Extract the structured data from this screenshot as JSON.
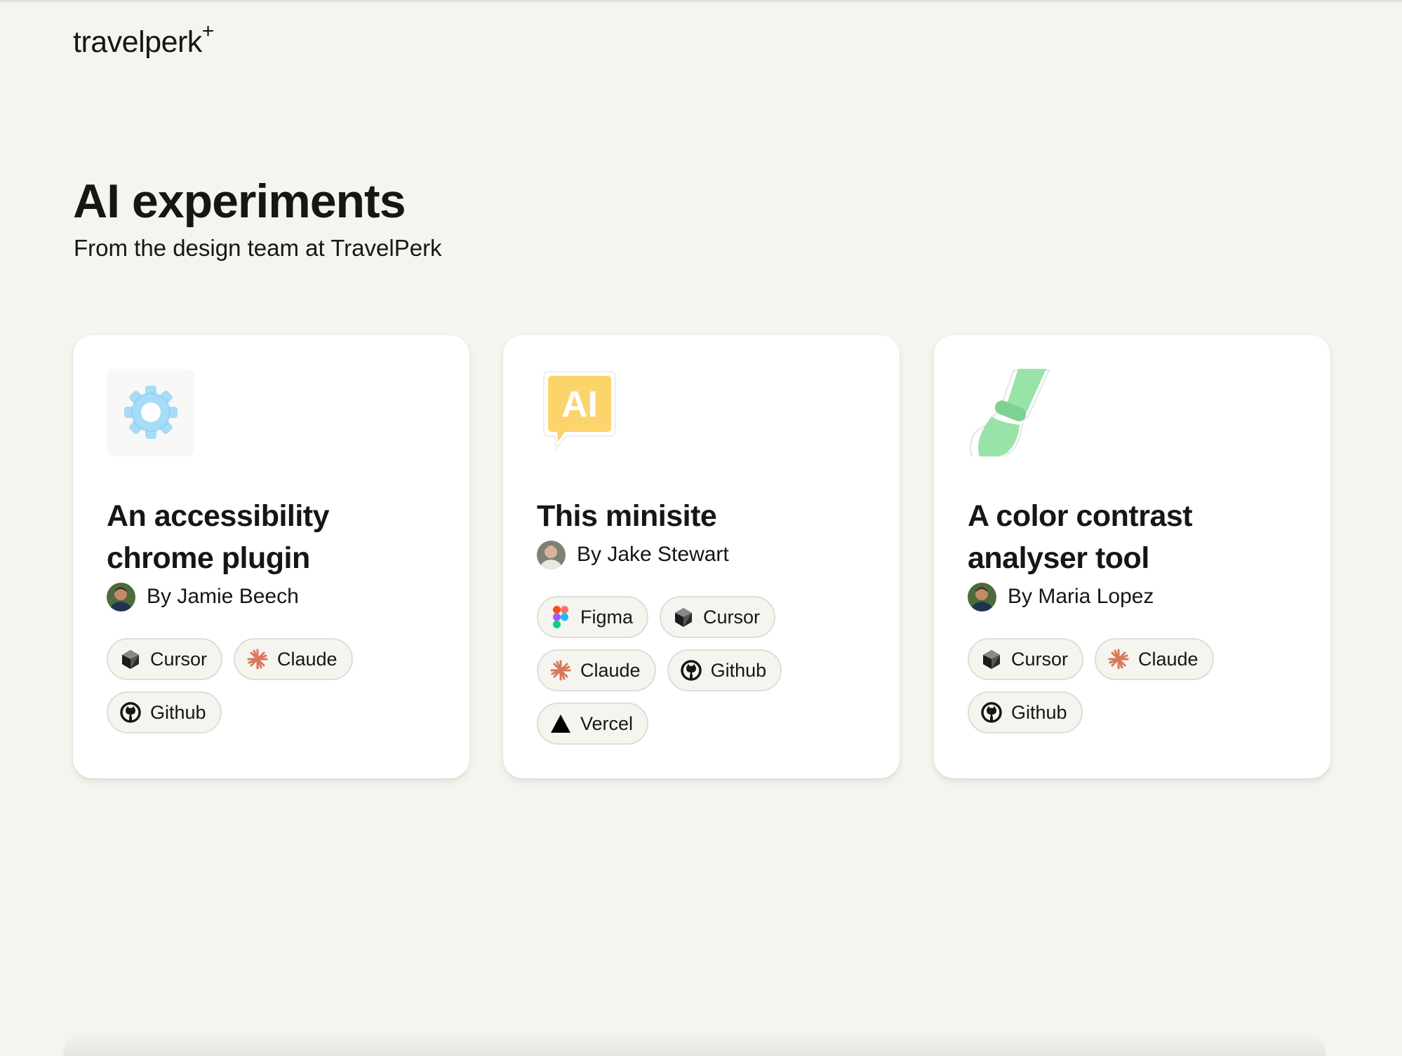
{
  "brand": {
    "logo_text": "travelperk",
    "logo_mark": "+"
  },
  "header": {
    "title": "AI experiments",
    "subtitle": "From the design team at TravelPerk"
  },
  "cards": [
    {
      "title": "An accessibility chrome plugin",
      "author": "By Jamie Beech",
      "icon": "gear-icon",
      "tags": [
        {
          "label": "Cursor",
          "icon": "cursor-icon"
        },
        {
          "label": "Claude",
          "icon": "claude-icon"
        },
        {
          "label": "Github",
          "icon": "github-icon"
        }
      ]
    },
    {
      "title": "This minisite",
      "author": "By Jake Stewart",
      "icon": "ai-chat-icon",
      "icon_text": "AI",
      "tags": [
        {
          "label": "Figma",
          "icon": "figma-icon"
        },
        {
          "label": "Cursor",
          "icon": "cursor-icon"
        },
        {
          "label": "Claude",
          "icon": "claude-icon"
        },
        {
          "label": "Github",
          "icon": "github-icon"
        },
        {
          "label": "Vercel",
          "icon": "vercel-icon"
        }
      ]
    },
    {
      "title": "A color contrast analyser tool",
      "author": "By Maria Lopez",
      "icon": "paintbrush-icon",
      "tags": [
        {
          "label": "Cursor",
          "icon": "cursor-icon"
        },
        {
          "label": "Claude",
          "icon": "claude-icon"
        },
        {
          "label": "Github",
          "icon": "github-icon"
        }
      ]
    }
  ],
  "colors": {
    "background": "#f5f4ee",
    "card": "#ffffff",
    "tag_background": "#f5f4ee",
    "claude": "#d9775a",
    "gear": "#8fd0f3",
    "ai_badge": "#fcd46c",
    "brush": "#8fde9e"
  }
}
